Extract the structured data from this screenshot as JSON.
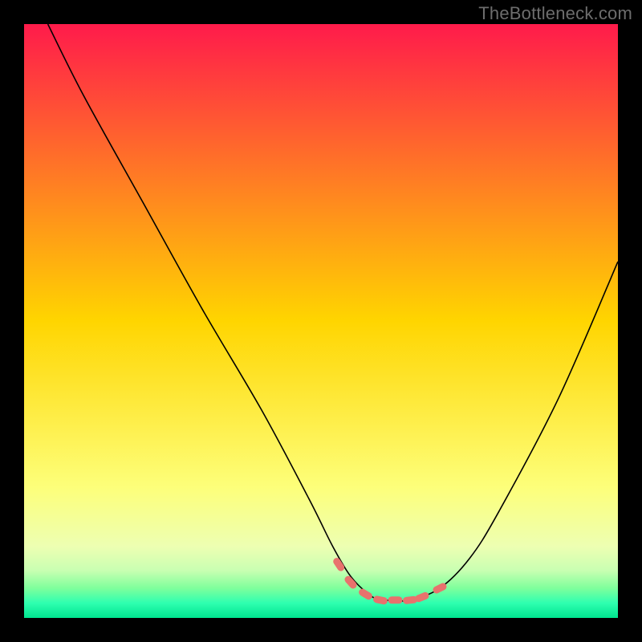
{
  "watermark": "TheBottleneck.com",
  "chart_data": {
    "type": "line",
    "title": "",
    "xlabel": "",
    "ylabel": "",
    "xlim": [
      0,
      100
    ],
    "ylim": [
      0,
      100
    ],
    "grid": false,
    "legend": false,
    "background_gradient": {
      "stops": [
        {
          "pos": 0.0,
          "color": "#ff1b4b"
        },
        {
          "pos": 0.5,
          "color": "#ffd500"
        },
        {
          "pos": 0.78,
          "color": "#fdff7a"
        },
        {
          "pos": 0.88,
          "color": "#edffb2"
        },
        {
          "pos": 0.92,
          "color": "#c9ffb2"
        },
        {
          "pos": 0.95,
          "color": "#7eff9c"
        },
        {
          "pos": 0.975,
          "color": "#2effb0"
        },
        {
          "pos": 1.0,
          "color": "#00e58f"
        }
      ]
    },
    "series": [
      {
        "name": "main-curve",
        "color": "#000000",
        "stroke_width": 1.6,
        "x": [
          4,
          10,
          20,
          30,
          40,
          48,
          52,
          55,
          58,
          60,
          62,
          65,
          70,
          75,
          80,
          90,
          100
        ],
        "values": [
          100,
          88,
          70,
          52,
          35,
          20,
          12,
          7,
          4,
          3,
          3,
          3,
          5,
          10,
          18,
          37,
          60
        ]
      }
    ],
    "markers": {
      "name": "flat-region-markers",
      "color": "#e8726d",
      "shape": "rounded-dash",
      "x": [
        53,
        55,
        57.5,
        60,
        62.5,
        65,
        67,
        70
      ],
      "values": [
        9,
        6,
        4,
        3,
        3,
        3,
        3.5,
        5
      ]
    }
  }
}
